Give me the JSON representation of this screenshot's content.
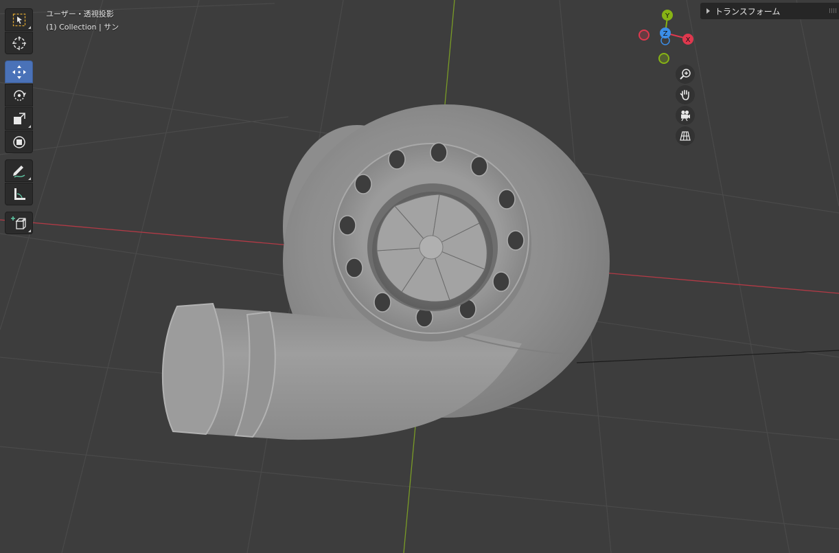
{
  "viewport": {
    "view_mode": "ユーザー・透視投影",
    "collection_info": "(1) Collection | サン"
  },
  "side_panel": {
    "title": "トランスフォーム"
  },
  "gizmo": {
    "axes": [
      "Y",
      "Z",
      "X"
    ],
    "colors": {
      "x": "#e0384e",
      "y": "#87b315",
      "z": "#3b8ee8"
    }
  },
  "toolbar": {
    "tools": [
      "select-box",
      "cursor",
      "move",
      "rotate",
      "scale",
      "transform",
      "annotate",
      "measure",
      "add-cube"
    ],
    "active_tool": "move"
  },
  "navigation": {
    "buttons": [
      "zoom",
      "pan",
      "camera",
      "perspective-toggle"
    ]
  },
  "colors": {
    "background": "#3d3d3d",
    "grid": "#4a4a4a",
    "x_axis_line": "#b33a46",
    "y_axis_line": "#7a9c26",
    "active_tool": "#4a72b8"
  }
}
